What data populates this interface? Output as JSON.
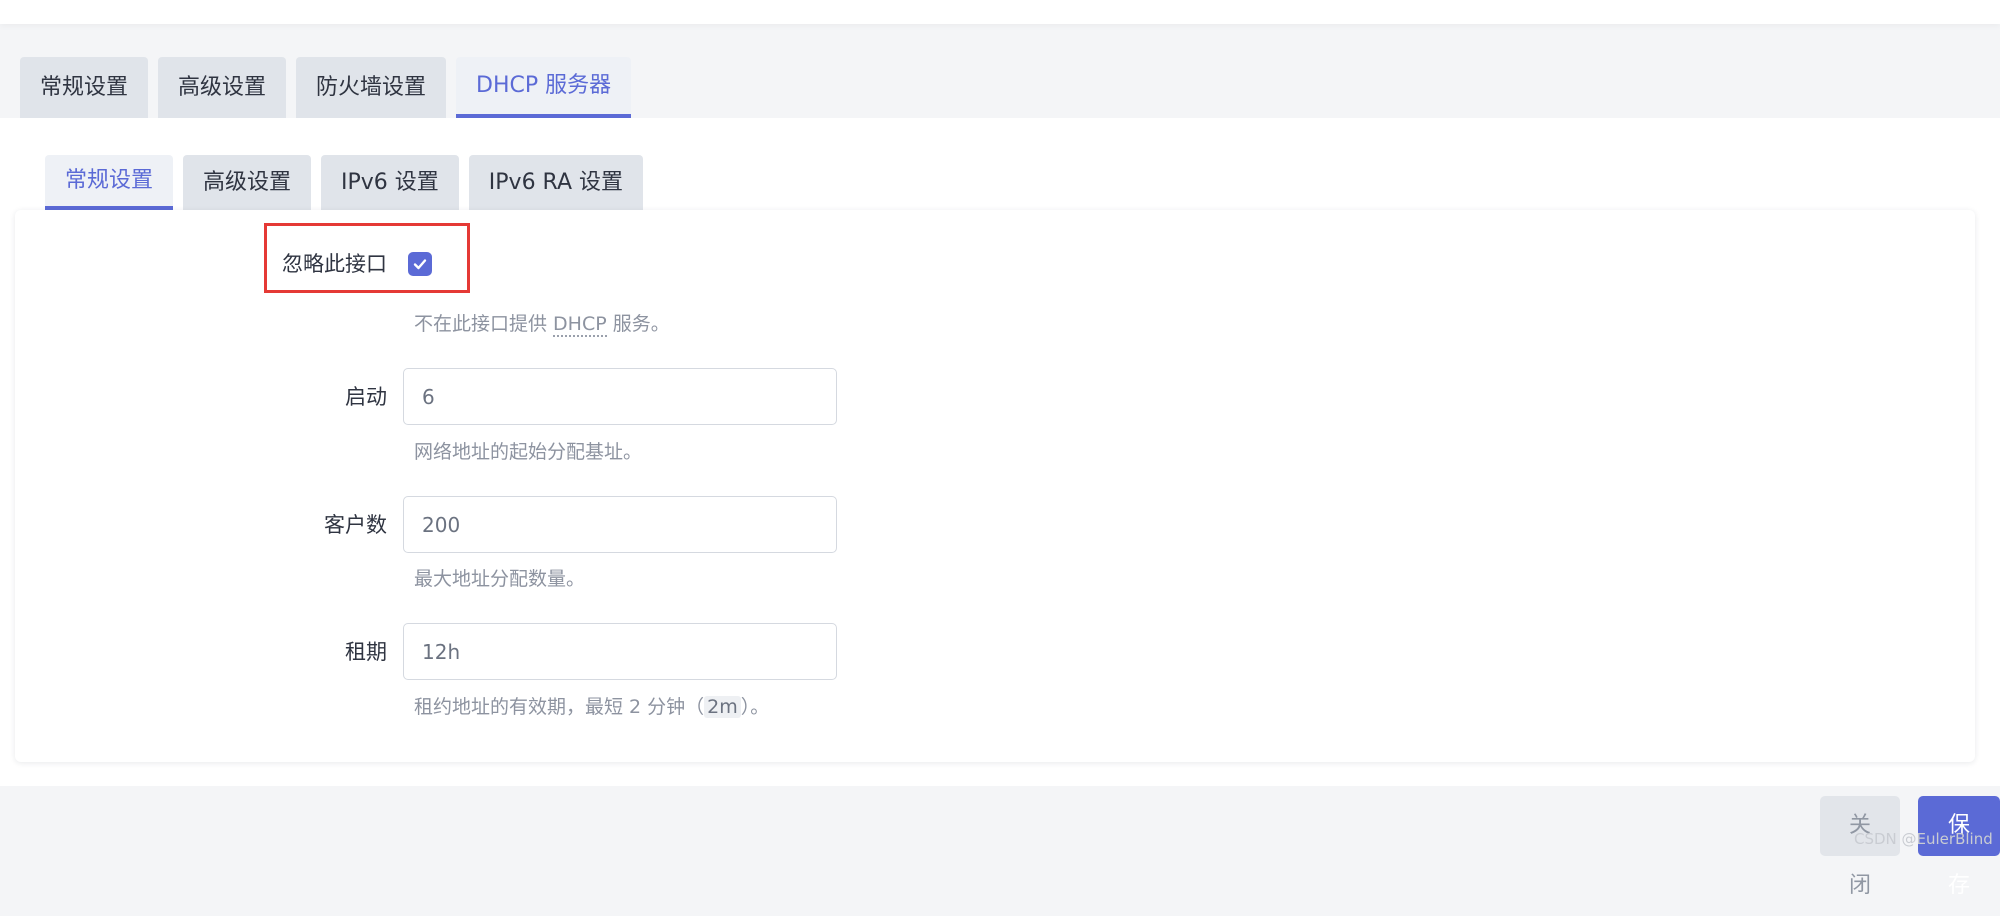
{
  "outer_tabs": [
    {
      "label": "常规设置",
      "active": false
    },
    {
      "label": "高级设置",
      "active": false
    },
    {
      "label": "防火墙设置",
      "active": false
    },
    {
      "label": "DHCP 服务器",
      "active": true
    }
  ],
  "inner_tabs": [
    {
      "label": "常规设置",
      "active": true
    },
    {
      "label": "高级设置",
      "active": false
    },
    {
      "label": "IPv6 设置",
      "active": false
    },
    {
      "label": "IPv6 RA 设置",
      "active": false
    }
  ],
  "form": {
    "ignore": {
      "label": "忽略此接口",
      "checked": true,
      "help_prefix": "不在此接口提供 ",
      "help_abbr": "DHCP",
      "help_suffix": " 服务。"
    },
    "start": {
      "label": "启动",
      "value": "6",
      "help": "网络地址的起始分配基址。"
    },
    "limit": {
      "label": "客户数",
      "value": "200",
      "help": "最大地址分配数量。"
    },
    "leasetime": {
      "label": "租期",
      "value": "12h",
      "help_prefix": "租约地址的有效期，最短 2 分钟（",
      "help_code": "2m",
      "help_suffix": "）。"
    }
  },
  "footer": {
    "close_label": "关闭",
    "save_label": "保存"
  },
  "watermark": "CSDN @EulerBlind",
  "colors": {
    "accent": "#5b6ad6",
    "highlight": "#e53935",
    "tab_bg": "#e0e4ea"
  }
}
